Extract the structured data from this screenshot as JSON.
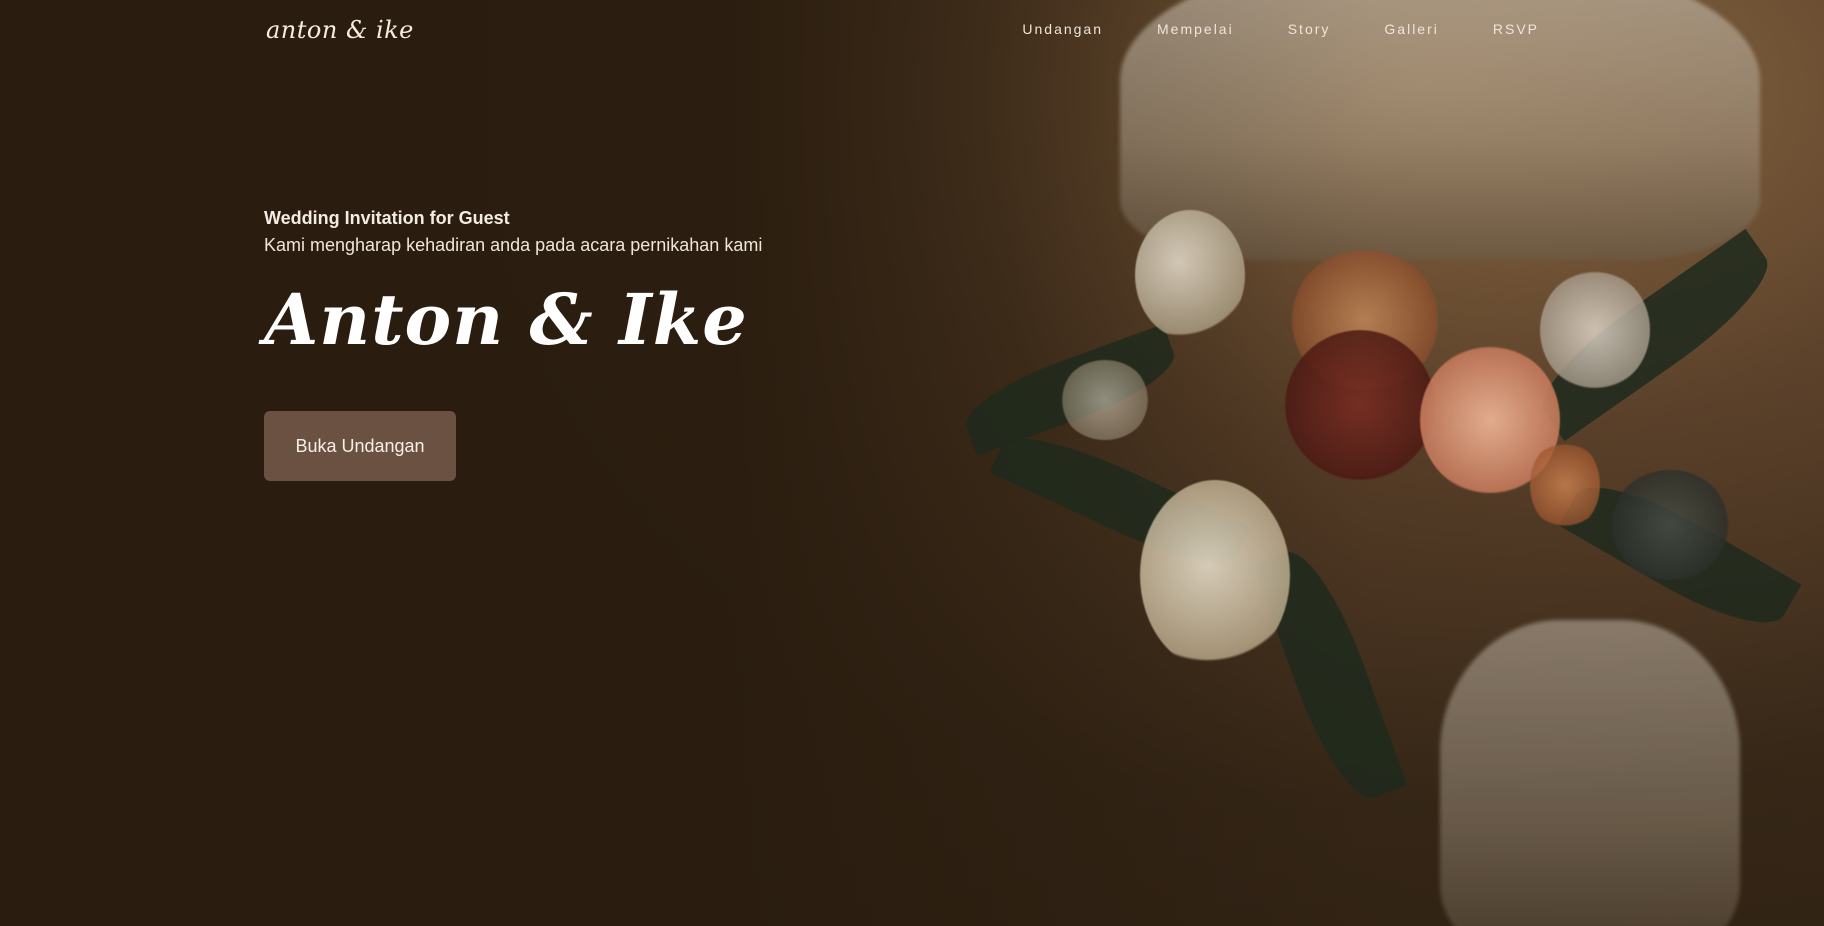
{
  "brand": {
    "logo_text": "anton & ike"
  },
  "nav": {
    "items": [
      {
        "label": "Undangan"
      },
      {
        "label": "Mempelai"
      },
      {
        "label": "Story"
      },
      {
        "label": "Galleri"
      },
      {
        "label": "RSVP"
      }
    ]
  },
  "hero": {
    "kicker": "Wedding Invitation for Guest",
    "lead": "Kami mengharap kehadiran anda pada acara pernikahan kami",
    "couple_names": "Anton & Ike",
    "cta_label": "Buka Undangan",
    "background_image_desc_icon": "bouquet-photo-icon"
  },
  "colors": {
    "background": "#2a1d0f",
    "button": "#6b5141",
    "text": "#f4ece2"
  }
}
